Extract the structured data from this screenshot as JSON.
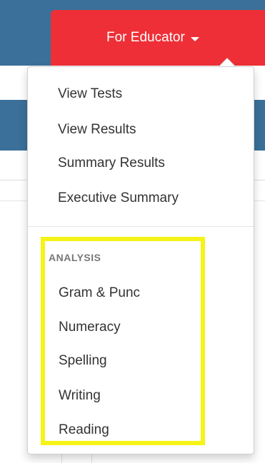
{
  "navbar": {
    "educator_label": "For Educator"
  },
  "dropdown": {
    "items": [
      {
        "label": "View Tests"
      },
      {
        "label": "View Results"
      },
      {
        "label": "Summary Results"
      },
      {
        "label": "Executive Summary"
      }
    ],
    "analysis": {
      "header": "ANALYSIS",
      "items": [
        {
          "label": "Gram & Punc"
        },
        {
          "label": "Numeracy"
        },
        {
          "label": "Spelling"
        },
        {
          "label": "Writing"
        },
        {
          "label": "Reading"
        }
      ]
    }
  },
  "colors": {
    "navbar_blue": "#3a7099",
    "educator_red": "#ee2f37",
    "highlight_yellow": "#f6f316",
    "menu_text": "#333333",
    "header_text": "#777777"
  }
}
